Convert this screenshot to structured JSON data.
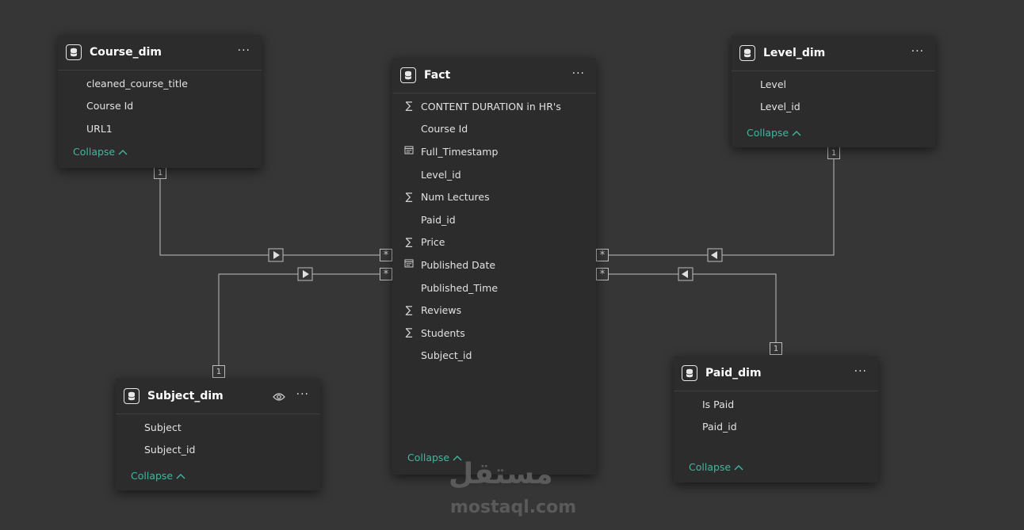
{
  "tables": {
    "course_dim": {
      "title": "Course_dim",
      "fields": [
        "cleaned_course_title",
        "Course Id",
        "URL1"
      ],
      "collapse": "Collapse",
      "cardinality": "1"
    },
    "fact": {
      "title": "Fact",
      "fields": [
        {
          "name": "CONTENT DURATION in HR's",
          "icon": "sigma-icon"
        },
        {
          "name": "Course Id",
          "icon": ""
        },
        {
          "name": "Full_Timestamp",
          "icon": "calendar-icon"
        },
        {
          "name": "Level_id",
          "icon": ""
        },
        {
          "name": "Num Lectures",
          "icon": "sigma-icon"
        },
        {
          "name": "Paid_id",
          "icon": ""
        },
        {
          "name": "Price",
          "icon": "sigma-icon"
        },
        {
          "name": "Published Date",
          "icon": "calendar-icon"
        },
        {
          "name": "Published_Time",
          "icon": ""
        },
        {
          "name": "Reviews",
          "icon": "sigma-icon"
        },
        {
          "name": "Students",
          "icon": "sigma-icon"
        },
        {
          "name": "Subject_id",
          "icon": ""
        }
      ],
      "collapse": "Collapse",
      "many": "*"
    },
    "level_dim": {
      "title": "Level_dim",
      "fields": [
        "Level",
        "Level_id"
      ],
      "collapse": "Collapse",
      "cardinality": "1"
    },
    "subject_dim": {
      "title": "Subject_dim",
      "fields": [
        "Subject",
        "Subject_id"
      ],
      "collapse": "Collapse",
      "cardinality": "1"
    },
    "paid_dim": {
      "title": "Paid_dim",
      "fields": [
        "Is Paid",
        "Paid_id"
      ],
      "collapse": "Collapse",
      "cardinality": "1"
    }
  },
  "menu_glyph": "···",
  "watermark": {
    "arabic": "مستقل",
    "latin": "mostaql.com"
  },
  "colors": {
    "canvas": "#363636",
    "card": "#2c2c2c",
    "accent": "#3fb8a0",
    "line": "#bdbdbd"
  }
}
